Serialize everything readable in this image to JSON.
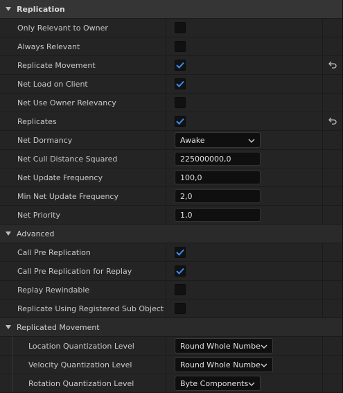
{
  "sections": {
    "replication": "Replication",
    "advanced": "Advanced",
    "replicated_movement": "Replicated Movement"
  },
  "props": {
    "only_relevant_to_owner": {
      "label": "Only Relevant to Owner",
      "checked": false
    },
    "always_relevant": {
      "label": "Always Relevant",
      "checked": false
    },
    "replicate_movement": {
      "label": "Replicate Movement",
      "checked": true,
      "reset": true
    },
    "net_load_on_client": {
      "label": "Net Load on Client",
      "checked": true
    },
    "net_use_owner_relevancy": {
      "label": "Net Use Owner Relevancy",
      "checked": false
    },
    "replicates": {
      "label": "Replicates",
      "checked": true,
      "reset": true
    },
    "net_dormancy": {
      "label": "Net Dormancy",
      "value": "Awake"
    },
    "net_cull_distance_squared": {
      "label": "Net Cull Distance Squared",
      "value": "225000000,0"
    },
    "net_update_frequency": {
      "label": "Net Update Frequency",
      "value": "100,0"
    },
    "min_net_update_frequency": {
      "label": "Min Net Update Frequency",
      "value": "2,0"
    },
    "net_priority": {
      "label": "Net Priority",
      "value": "1,0"
    },
    "call_pre_replication": {
      "label": "Call Pre Replication",
      "checked": true
    },
    "call_pre_replication_for_replay": {
      "label": "Call Pre Replication for Replay",
      "checked": true
    },
    "replay_rewindable": {
      "label": "Replay Rewindable",
      "checked": false
    },
    "replicate_using_registered_sub_object_list": {
      "label": "Replicate Using Registered Sub Object Li...",
      "checked": false
    },
    "location_quantization_level": {
      "label": "Location Quantization Level",
      "value": "Round Whole Number"
    },
    "velocity_quantization_level": {
      "label": "Velocity Quantization Level",
      "value": "Round Whole Number"
    },
    "rotation_quantization_level": {
      "label": "Rotation Quantization Level",
      "value": "Byte Components"
    }
  },
  "colors": {
    "checkmark": "#3b8cf5",
    "panel_bg": "#242424",
    "header_bg": "#353535"
  },
  "icons": {
    "collapse": "chevron-down-icon",
    "reset": "reset-to-default-icon",
    "dropdown": "chevron-down-icon"
  }
}
